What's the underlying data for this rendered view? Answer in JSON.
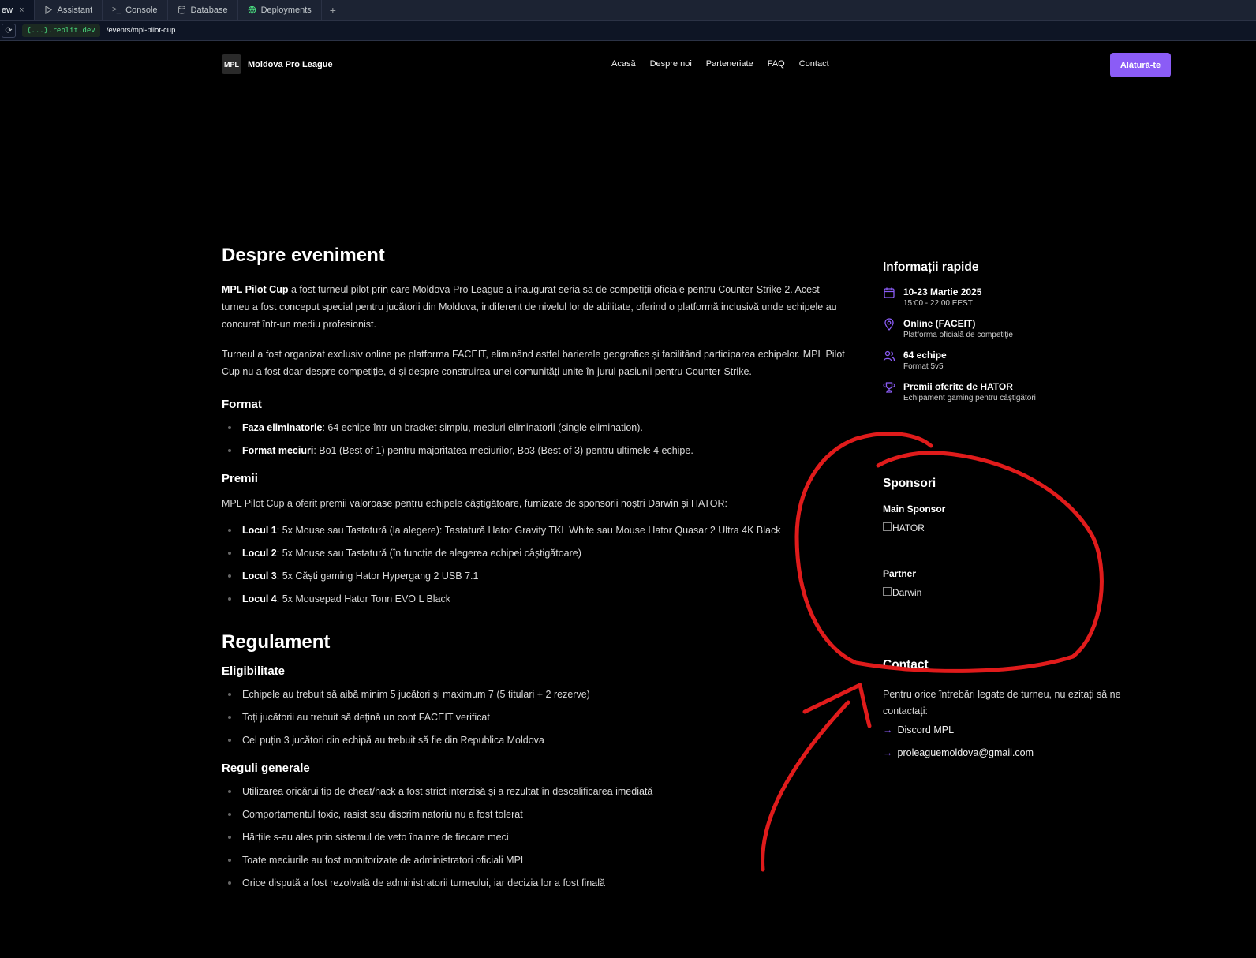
{
  "replit": {
    "tabs": [
      {
        "label": "ew",
        "active": true
      },
      {
        "label": "Assistant"
      },
      {
        "label": "Console"
      },
      {
        "label": "Database"
      },
      {
        "label": "Deployments"
      }
    ],
    "close_glyph": "×",
    "plus_glyph": "+",
    "host": "{...}.replit.dev",
    "path": "/events/mpl-pilot-cup"
  },
  "site": {
    "logo_mark": "MPL",
    "logo_name": "Moldova Pro League",
    "nav": [
      "Acasă",
      "Despre noi",
      "Parteneriate",
      "FAQ",
      "Contact"
    ],
    "cta": "Alătură-te",
    "accent": "#8b5cf6"
  },
  "about": {
    "title": "Despre eveniment",
    "p1_bold": "MPL Pilot Cup",
    "p1_rest": " a fost turneul pilot prin care Moldova Pro League a inaugurat seria sa de competiții oficiale pentru Counter-Strike 2. Acest turneu a fost conceput special pentru jucătorii din Moldova, indiferent de nivelul lor de abilitate, oferind o platformă inclusivă unde echipele au concurat într-un mediu profesionist.",
    "p2": "Turneul a fost organizat exclusiv online pe platforma FACEIT, eliminând astfel barierele geografice și facilitând participarea echipelor. MPL Pilot Cup nu a fost doar despre competiție, ci și despre construirea unei comunități unite în jurul pasiunii pentru Counter-Strike.",
    "format_title": "Format",
    "format": [
      {
        "bold": "Faza eliminatorie",
        "text": ": 64 echipe într-un bracket simplu, meciuri eliminatorii (single elimination)."
      },
      {
        "bold": "Format meciuri",
        "text": ": Bo1 (Best of 1) pentru majoritatea meciurilor, Bo3 (Best of 3) pentru ultimele 4 echipe."
      }
    ],
    "prizes_title": "Premii",
    "prizes_intro": "MPL Pilot Cup a oferit premii valoroase pentru echipele câștigătoare, furnizate de sponsorii noștri Darwin și HATOR:",
    "prizes": [
      {
        "bold": "Locul 1",
        "text": ": 5x Mouse sau Tastatură (la alegere): Tastatură Hator Gravity TKL White sau Mouse Hator Quasar 2 Ultra 4K Black"
      },
      {
        "bold": "Locul 2",
        "text": ": 5x Mouse sau Tastatură (în funcție de alegerea echipei câștigătoare)"
      },
      {
        "bold": "Locul 3",
        "text": ": 5x Căști gaming Hator Hypergang 2 USB 7.1"
      },
      {
        "bold": "Locul 4",
        "text": ": 5x Mousepad Hator Tonn EVO L Black"
      }
    ]
  },
  "rules": {
    "title": "Regulament",
    "elig_title": "Eligibilitate",
    "elig": [
      "Echipele au trebuit să aibă minim 5 jucători și maximum 7 (5 titulari + 2 rezerve)",
      "Toți jucătorii au trebuit să dețină un cont FACEIT verificat",
      "Cel puțin 3 jucători din echipă au trebuit să fie din Republica Moldova"
    ],
    "general_title": "Reguli generale",
    "general": [
      "Utilizarea oricărui tip de cheat/hack a fost strict interzisă și a rezultat în descalificarea imediată",
      "Comportamentul toxic, rasist sau discriminatoriu nu a fost tolerat",
      "Hărțile s-au ales prin sistemul de veto înainte de fiecare meci",
      "Toate meciurile au fost monitorizate de administratori oficiali MPL",
      "Orice dispută a fost rezolvată de administratorii turneului, iar decizia lor a fost finală"
    ]
  },
  "quick_info": {
    "title": "Informații rapide",
    "items": [
      {
        "icon": "calendar-icon",
        "title": "10-23 Martie 2025",
        "sub": "15:00 - 22:00 EEST"
      },
      {
        "icon": "location-pin-icon",
        "title": "Online (FACEIT)",
        "sub": "Platforma oficială de competiție"
      },
      {
        "icon": "users-icon",
        "title": "64 echipe",
        "sub": "Format 5v5"
      },
      {
        "icon": "trophy-icon",
        "title": "Premii oferite de HATOR",
        "sub": "Echipament gaming pentru câștigători"
      }
    ]
  },
  "sponsors": {
    "title": "Sponsori",
    "main_label": "Main Sponsor",
    "main_alt": "HATOR",
    "partner_label": "Partner",
    "partner_alt": "Darwin"
  },
  "contact": {
    "title": "Contact",
    "text": "Pentru orice întrebări legate de turneu, nu ezitați să ne contactați:",
    "arrow": "→",
    "links": [
      "Discord MPL",
      "proleaguemoldova@gmail.com"
    ]
  },
  "annotation_color": "#e01b1b"
}
